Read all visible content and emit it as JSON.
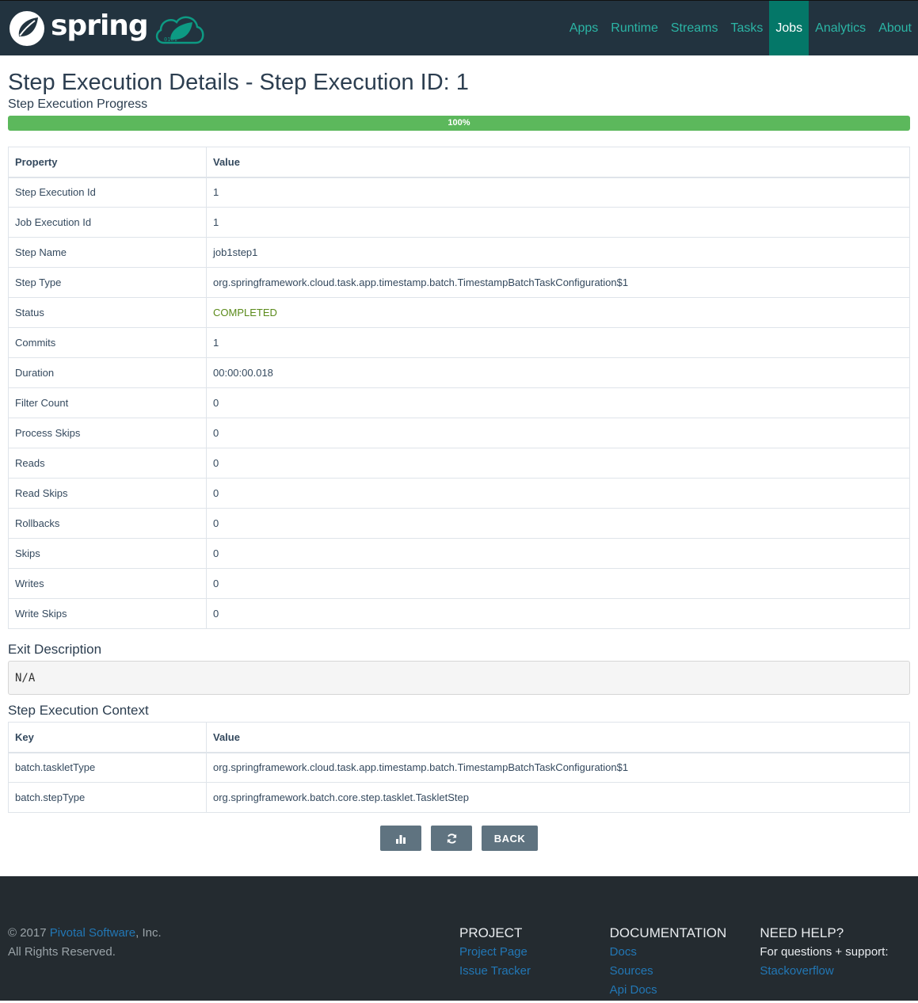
{
  "header": {
    "brand": "spring",
    "nav": [
      {
        "label": "Apps",
        "active": false
      },
      {
        "label": "Runtime",
        "active": false
      },
      {
        "label": "Streams",
        "active": false
      },
      {
        "label": "Tasks",
        "active": false
      },
      {
        "label": "Jobs",
        "active": true
      },
      {
        "label": "Analytics",
        "active": false
      },
      {
        "label": "About",
        "active": false
      }
    ]
  },
  "page": {
    "title": "Step Execution Details - Step Execution ID: 1",
    "progress_label": "Step Execution Progress",
    "progress_percent": 100,
    "progress_text": "100%"
  },
  "details_table": {
    "headers": [
      "Property",
      "Value"
    ],
    "rows": [
      {
        "property": "Step Execution Id",
        "value": "1"
      },
      {
        "property": "Job Execution Id",
        "value": "1"
      },
      {
        "property": "Step Name",
        "value": "job1step1"
      },
      {
        "property": "Step Type",
        "value": "org.springframework.cloud.task.app.timestamp.batch.TimestampBatchTaskConfiguration$1"
      },
      {
        "property": "Status",
        "value": "COMPLETED"
      },
      {
        "property": "Commits",
        "value": "1"
      },
      {
        "property": "Duration",
        "value": "00:00:00.018"
      },
      {
        "property": "Filter Count",
        "value": "0"
      },
      {
        "property": "Process Skips",
        "value": "0"
      },
      {
        "property": "Reads",
        "value": "0"
      },
      {
        "property": "Read Skips",
        "value": "0"
      },
      {
        "property": "Rollbacks",
        "value": "0"
      },
      {
        "property": "Skips",
        "value": "0"
      },
      {
        "property": "Writes",
        "value": "0"
      },
      {
        "property": "Write Skips",
        "value": "0"
      }
    ]
  },
  "exit_description": {
    "label": "Exit Description",
    "value": "N/A"
  },
  "context_table": {
    "label": "Step Execution Context",
    "headers": [
      "Key",
      "Value"
    ],
    "rows": [
      {
        "key": "batch.taskletType",
        "value": "org.springframework.cloud.task.app.timestamp.batch.TimestampBatchTaskConfiguration$1"
      },
      {
        "key": "batch.stepType",
        "value": "org.springframework.batch.core.step.tasklet.TaskletStep"
      }
    ]
  },
  "actions": {
    "chart_icon": "bar-chart-icon",
    "refresh_icon": "refresh-icon",
    "back_label": "BACK"
  },
  "colors": {
    "nav_bg": "#22333f",
    "nav_link": "#2bb5a5",
    "nav_active_bg": "#047768",
    "progress": "#5cb85c",
    "status_completed": "#5a8a1a",
    "button": "#5f7380",
    "footer_bg": "#242b30",
    "footer_link": "#2277b5"
  },
  "footer": {
    "copyright_prefix": "© 2017 ",
    "company_link": "Pivotal Software",
    "copyright_suffix": ", Inc.",
    "rights": "All Rights Reserved.",
    "project": {
      "title": "PROJECT",
      "links": [
        "Project Page",
        "Issue Tracker"
      ]
    },
    "documentation": {
      "title": "DOCUMENTATION",
      "links": [
        "Docs",
        "Sources",
        "Api Docs"
      ]
    },
    "help": {
      "title": "NEED HELP?",
      "text": "For questions + support:",
      "links": [
        "Stackoverflow"
      ]
    }
  }
}
